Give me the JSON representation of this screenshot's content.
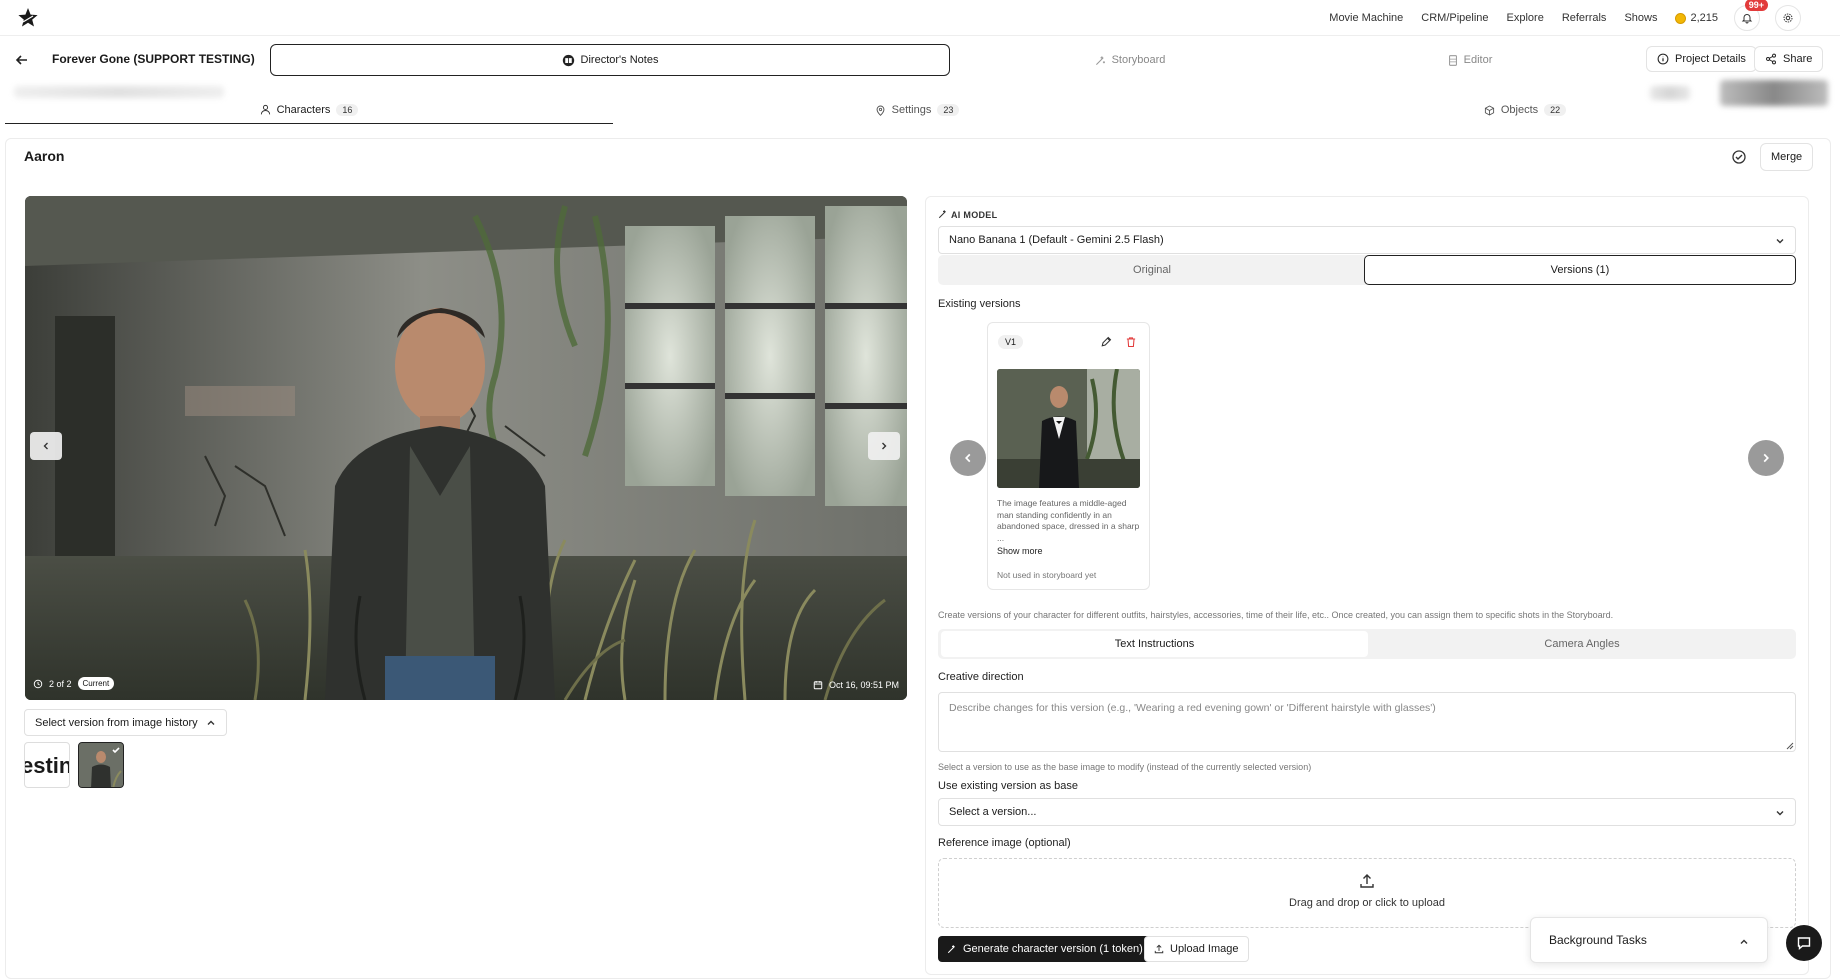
{
  "nav": {
    "links": [
      "Movie Machine",
      "CRM/Pipeline",
      "Explore",
      "Referrals",
      "Shows"
    ],
    "tokens": "2,215",
    "notif_badge": "99+"
  },
  "project": {
    "title": "Forever Gone (SUPPORT TESTING)",
    "tabs": [
      "Director's Notes",
      "Storyboard",
      "Editor"
    ],
    "details_label": "Project Details",
    "share_label": "Share"
  },
  "categories": [
    {
      "label": "Characters",
      "count": "16"
    },
    {
      "label": "Settings",
      "count": "23"
    },
    {
      "label": "Objects",
      "count": "22"
    }
  ],
  "character": {
    "name": "Aaron",
    "merge_label": "Merge",
    "image_counter": "2 of 2",
    "current_label": "Current",
    "image_date": "Oct 16, 09:51 PM",
    "history_label": "Select version from image history",
    "thumb_text": "estin"
  },
  "panel": {
    "ai_model_label": "AI MODEL",
    "ai_model_value": "Nano Banana 1 (Default - Gemini 2.5 Flash)",
    "tabs": [
      "Original",
      "Versions (1)"
    ],
    "existing_versions_label": "Existing versions",
    "version": {
      "tag": "V1",
      "description": "The image features a middle-aged man standing confidently in an abandoned space, dressed in a sharp ...",
      "show_more": "Show more",
      "usage": "Not used in storyboard yet"
    },
    "versions_hint": "Create versions of your character for different outfits, hairstyles, accessories, time of their life, etc.. Once created, you can assign them to specific shots in the Storyboard.",
    "instruction_tabs": [
      "Text Instructions",
      "Camera Angles"
    ],
    "creative_direction_label": "Creative direction",
    "creative_direction_placeholder": "Describe changes for this version (e.g., 'Wearing a red evening gown' or 'Different hairstyle with glasses')",
    "base_hint": "Select a version to use as the base image to modify (instead of the currently selected version)",
    "base_label": "Use existing version as base",
    "base_placeholder": "Select a version...",
    "reference_label": "Reference image (optional)",
    "dropzone_text": "Drag and drop or click to upload",
    "generate_label": "Generate character version (1 token)",
    "upload_label": "Upload Image"
  },
  "background_tasks_label": "Background Tasks"
}
